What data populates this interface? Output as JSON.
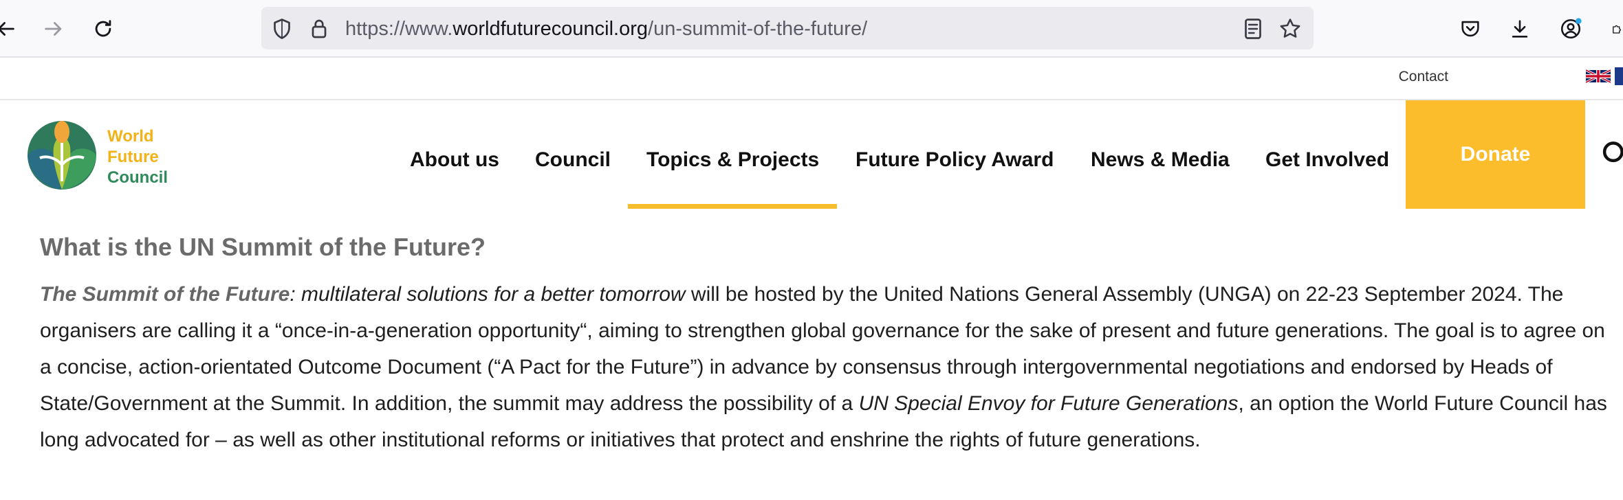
{
  "browser": {
    "url_prefix": "https://www.",
    "url_domain": "worldfuturecouncil.org",
    "url_path": "/un-summit-of-the-future/"
  },
  "top_strip": {
    "contact_label": "Contact"
  },
  "logo": {
    "line1": "World",
    "line2": "Future",
    "line3": "Council"
  },
  "nav": {
    "items": [
      {
        "label": "About us"
      },
      {
        "label": "Council"
      },
      {
        "label": "Topics & Projects",
        "active": true
      },
      {
        "label": "Future Policy Award"
      },
      {
        "label": "News & Media"
      },
      {
        "label": "Get Involved"
      }
    ],
    "donate_label": "Donate"
  },
  "colors": {
    "accent": "#fbbd2c",
    "logo_green": "#2f8a5b",
    "logo_yellow": "#f2b31a"
  },
  "article": {
    "heading": "What is the UN Summit of the Future?",
    "p1_bold": "The Summit of the Future",
    "p1_italic": ": multilateral solutions for a better tomorrow",
    "p1_text": " will be hosted by the United Nations General Assembly (UNGA) on 22-23 September 2024. The organisers are calling it a “once-in-a-generation opportunity“, aiming to strengthen global governance for the sake of present and future generations. The goal is to agree on a concise, action-orientated Outcome Document (“A Pact for the Future”)  in advance by consensus through intergovernmental negotiations and endorsed by Heads of State/Government at the Summit. In addition, the summit may address the possibility of a ",
    "p1_italic2": "UN Special Envoy for Future Generations",
    "p1_text2": ", an option the World Future Council has long advocated for – as well as other institutional reforms or initiatives that protect and enshrine the rights of future generations."
  }
}
